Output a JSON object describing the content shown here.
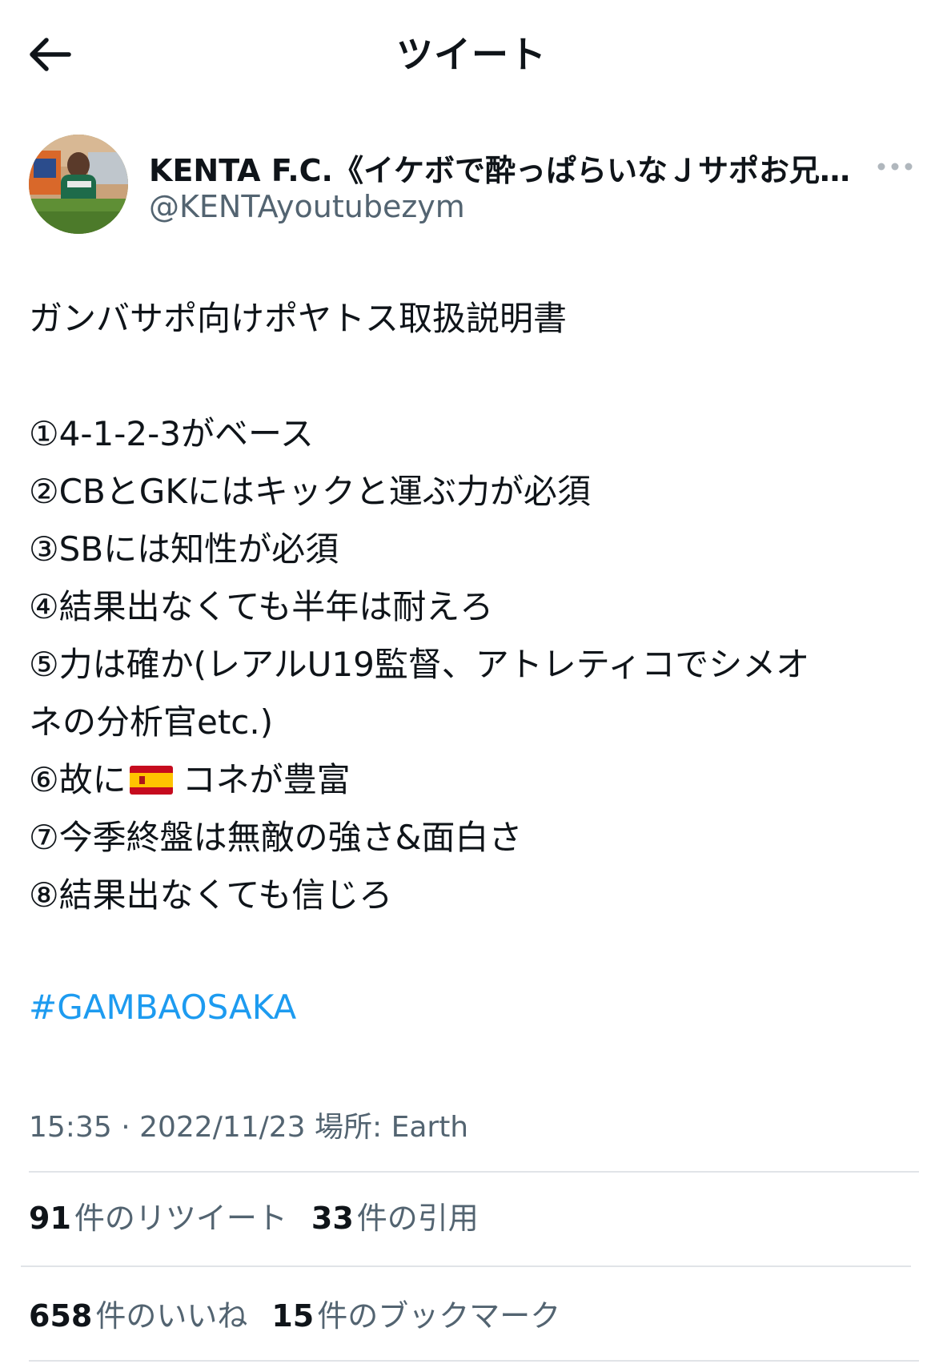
{
  "header": {
    "title": "ツイート",
    "back_icon": "arrow-left-icon"
  },
  "author": {
    "display_name": "KENTA F.C.《イケボで酔っぱらいなＪサポお兄…",
    "handle": "@KENTAyoutubezym",
    "more_icon": "more-horizontal-icon"
  },
  "tweet": {
    "lines": [
      "ガンバサポ向けポヤトス取扱説明書",
      "",
      "①4-1-2-3がベース",
      "②CBとGKにはキックと運ぶ力が必須",
      "③SBには知性が必須",
      "④結果出なくても半年は耐えろ",
      "⑤力は確か(レアルU19監督、アトレティコでシメオ",
      "ネの分析官etc.)",
      "⑥故に",
      "⑦今季終盤は無敵の強さ&面白さ",
      "⑧結果出なくても信じろ"
    ],
    "line6_suffix": "コネが豊富",
    "flag_icon": "spain-flag-icon",
    "hashtag": "#GAMBAOSAKA"
  },
  "meta": {
    "text": "15:35 · 2022/11/23 場所: Earth"
  },
  "stats": {
    "retweets_count": "91",
    "retweets_label": "件のリツイート",
    "quotes_count": "33",
    "quotes_label": "件の引用",
    "likes_count": "658",
    "likes_label": "件のいいね",
    "bookmarks_count": "15",
    "bookmarks_label": "件のブックマーク"
  },
  "colors": {
    "link": "#1d9bf0",
    "secondary_text": "#536471",
    "divider": "#e1e4e8"
  }
}
